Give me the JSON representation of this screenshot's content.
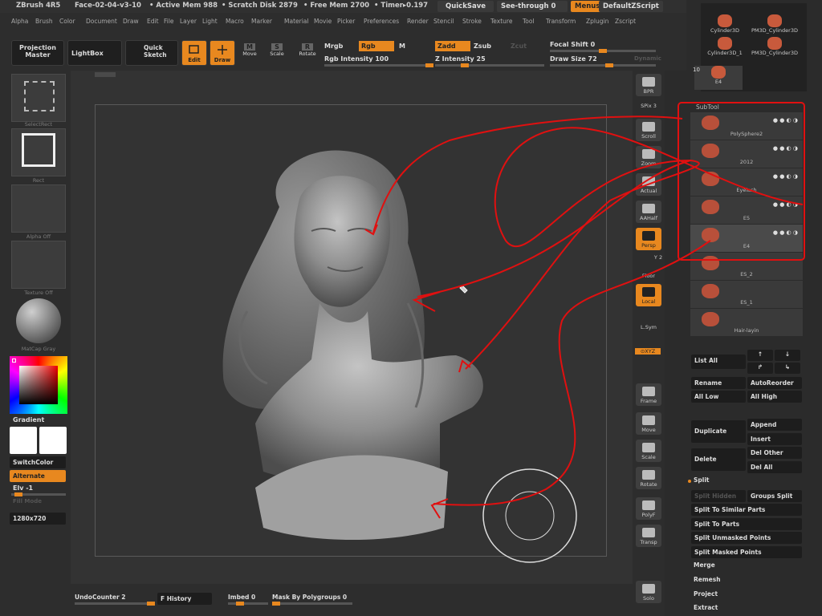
{
  "title_bar": {
    "app": "ZBrush 4R5",
    "document": "Face-02-04-v3-10",
    "active_mem": "• Active Mem 988",
    "scratch_disk": "• Scratch Disk 2879",
    "free_mem": "• Free Mem 2700",
    "timer": "• Timer▸0.197",
    "quicksave": "QuickSave",
    "see_through": "See-through   0",
    "menus": "Menus",
    "default_zscript": "DefaultZScript"
  },
  "menus": [
    "Alpha",
    "Brush",
    "Color",
    "Document",
    "Draw",
    "Edit",
    "File",
    "Layer",
    "Light",
    "Macro",
    "Marker",
    "Material",
    "Movie",
    "Picker",
    "Preferences",
    "Render",
    "Stencil",
    "Stroke",
    "Texture",
    "Tool",
    "Transform",
    "Zplugin",
    "Zscript"
  ],
  "toolbar": {
    "projection_master": "Projection Master",
    "lightbox": "LightBox",
    "quick_sketch": "Quick Sketch",
    "edit": "Edit",
    "draw": "Draw",
    "move": "Move",
    "scale": "Scale",
    "rotate": "Rotate",
    "mrgb": "Mrgb",
    "rgb": "Rgb",
    "m": "M",
    "rgb_intensity": "Rgb  Intensity 100",
    "zadd": "Zadd",
    "zsub": "Zsub",
    "zcut": "Zcut",
    "z_intensity": "Z  Intensity 25",
    "focal_shift": "Focal Shift 0",
    "draw_size": "Draw  Size 72",
    "dynamic": "Dynamic",
    "icons": {
      "move": "M",
      "scale": "S",
      "rotate": "R"
    },
    "rgb_intensity_value": 100,
    "z_intensity_value": 25,
    "focal_shift_value": 0,
    "draw_size_value": 72
  },
  "left_shelf": {
    "select_rect": "SelectRect",
    "rect": "Rect",
    "alpha_off": "Alpha Off",
    "texture_off": "Texture Off",
    "matcap_gray": "MatCap Gray",
    "gradient": "Gradient",
    "switch_color": "SwitchColor",
    "alternate": "Alternate",
    "elv": "Elv -1",
    "fill_mode": "Fill Mode",
    "doc_size": "1280x720"
  },
  "right_shelf": {
    "bpr": "BPR",
    "spix": "SPix 3",
    "scroll": "Scroll",
    "zoom": "Zoom",
    "actual": "Actual",
    "aahalf": "AAHalf",
    "persp": "Persp",
    "floor": "Floor",
    "local": "Local",
    "lsym": "L.Sym",
    "xyz": "⊙XYZ",
    "frame": "Frame",
    "move": "Move",
    "scale": "Scale",
    "rotate": "Rotate",
    "polyf": "PolyF",
    "transp": "Transp",
    "solo": "Solo",
    "y2": "Y 2"
  },
  "tool_thumbs": [
    "Cylinder3D",
    "PM3D_Cylinder3D",
    "Cylinder3D_1",
    "PM3D_Cylinder3D",
    "E4"
  ],
  "tool_thumb_count": "10",
  "subtool": {
    "header": "SubTool",
    "items": [
      "PolySphere2",
      "2012",
      "Eyelash",
      "E5",
      "E4",
      "ES_2",
      "ES_1",
      "Hair-layin"
    ]
  },
  "tool_buttons": {
    "list_all": "List All",
    "rename": "Rename",
    "auto_reorder": "AutoReorder",
    "all_low": "All Low",
    "all_high": "All High",
    "duplicate": "Duplicate",
    "append": "Append",
    "insert": "Insert",
    "delete": "Delete",
    "del_other": "Del Other",
    "del_all": "Del All",
    "split": "Split",
    "split_hidden": "Split Hidden",
    "groups_split": "Groups Split",
    "split_similar": "Split To Similar Parts",
    "split_parts": "Split To Parts",
    "split_unmasked": "Split Unmasked Points",
    "split_masked": "Split Masked Points",
    "merge": "Merge",
    "remesh": "Remesh",
    "project": "Project",
    "extract": "Extract"
  },
  "bottom_bar": {
    "undo_counter": "UndoCounter 2",
    "f_history": "F History",
    "imbed": "Imbed 0",
    "mask_by_polygroups": "Mask By Polygroups 0"
  },
  "colors": {
    "accent": "#e8881f",
    "annotation": "#e01010",
    "bg": "#2b2b2b"
  }
}
